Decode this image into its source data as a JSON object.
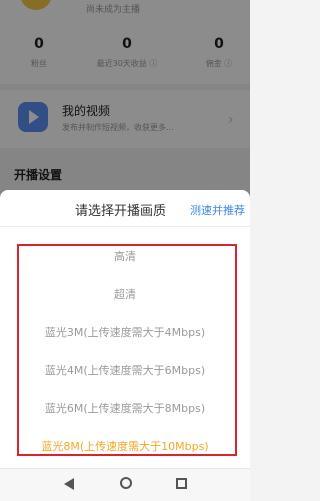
{
  "profile": {
    "subtitle": "尚未成为主播",
    "stats": [
      {
        "value": "0",
        "label": "粉丝"
      },
      {
        "value": "0",
        "label": "最近30天收益 ⓘ"
      },
      {
        "value": "0",
        "label": "佣金 ⓘ"
      }
    ]
  },
  "video_card": {
    "title": "我的视频",
    "description": "发布并制作短视频，收获更多..."
  },
  "section": {
    "title": "开播设置"
  },
  "sheet": {
    "title": "请选择开播画质",
    "speed_test_link": "测速并推荐",
    "options": [
      {
        "label": "高清"
      },
      {
        "label": "超清"
      },
      {
        "label": "蓝光3M(上传速度需大于4Mbps)"
      },
      {
        "label": "蓝光4M(上传速度需大于6Mbps)"
      },
      {
        "label": "蓝光6M(上传速度需大于8Mbps)"
      },
      {
        "label": "蓝光8M(上传速度需大于10Mbps)"
      }
    ],
    "selected_index": 5
  },
  "colors": {
    "accent_link": "#3a86e6",
    "selected_option": "#f5a623",
    "highlight_box": "#d9242c"
  },
  "navbar": {
    "icons": [
      "back-triangle-icon",
      "home-circle-icon",
      "recent-apps-square-icon"
    ]
  }
}
